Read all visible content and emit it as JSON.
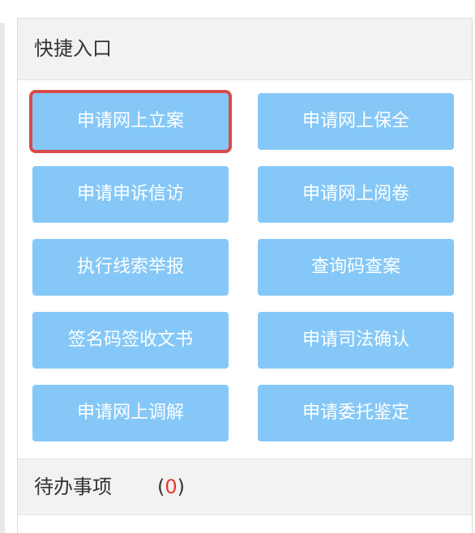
{
  "quick_entry": {
    "title": "快捷入口",
    "buttons": [
      {
        "label": "申请网上立案"
      },
      {
        "label": "申请网上保全"
      },
      {
        "label": "申请申诉信访"
      },
      {
        "label": "申请网上阅卷"
      },
      {
        "label": "执行线索举报"
      },
      {
        "label": "查询码查案"
      },
      {
        "label": "签名码签收文书"
      },
      {
        "label": "申请司法确认"
      },
      {
        "label": "申请网上调解"
      },
      {
        "label": "申请委托鉴定"
      }
    ]
  },
  "todo": {
    "title": "待办事项",
    "open_paren": "(",
    "count": "0",
    "close_paren": ")"
  },
  "colors": {
    "button_bg": "#85c8f7",
    "highlight_border": "#d84a4a",
    "count_color": "#e23b2e"
  }
}
